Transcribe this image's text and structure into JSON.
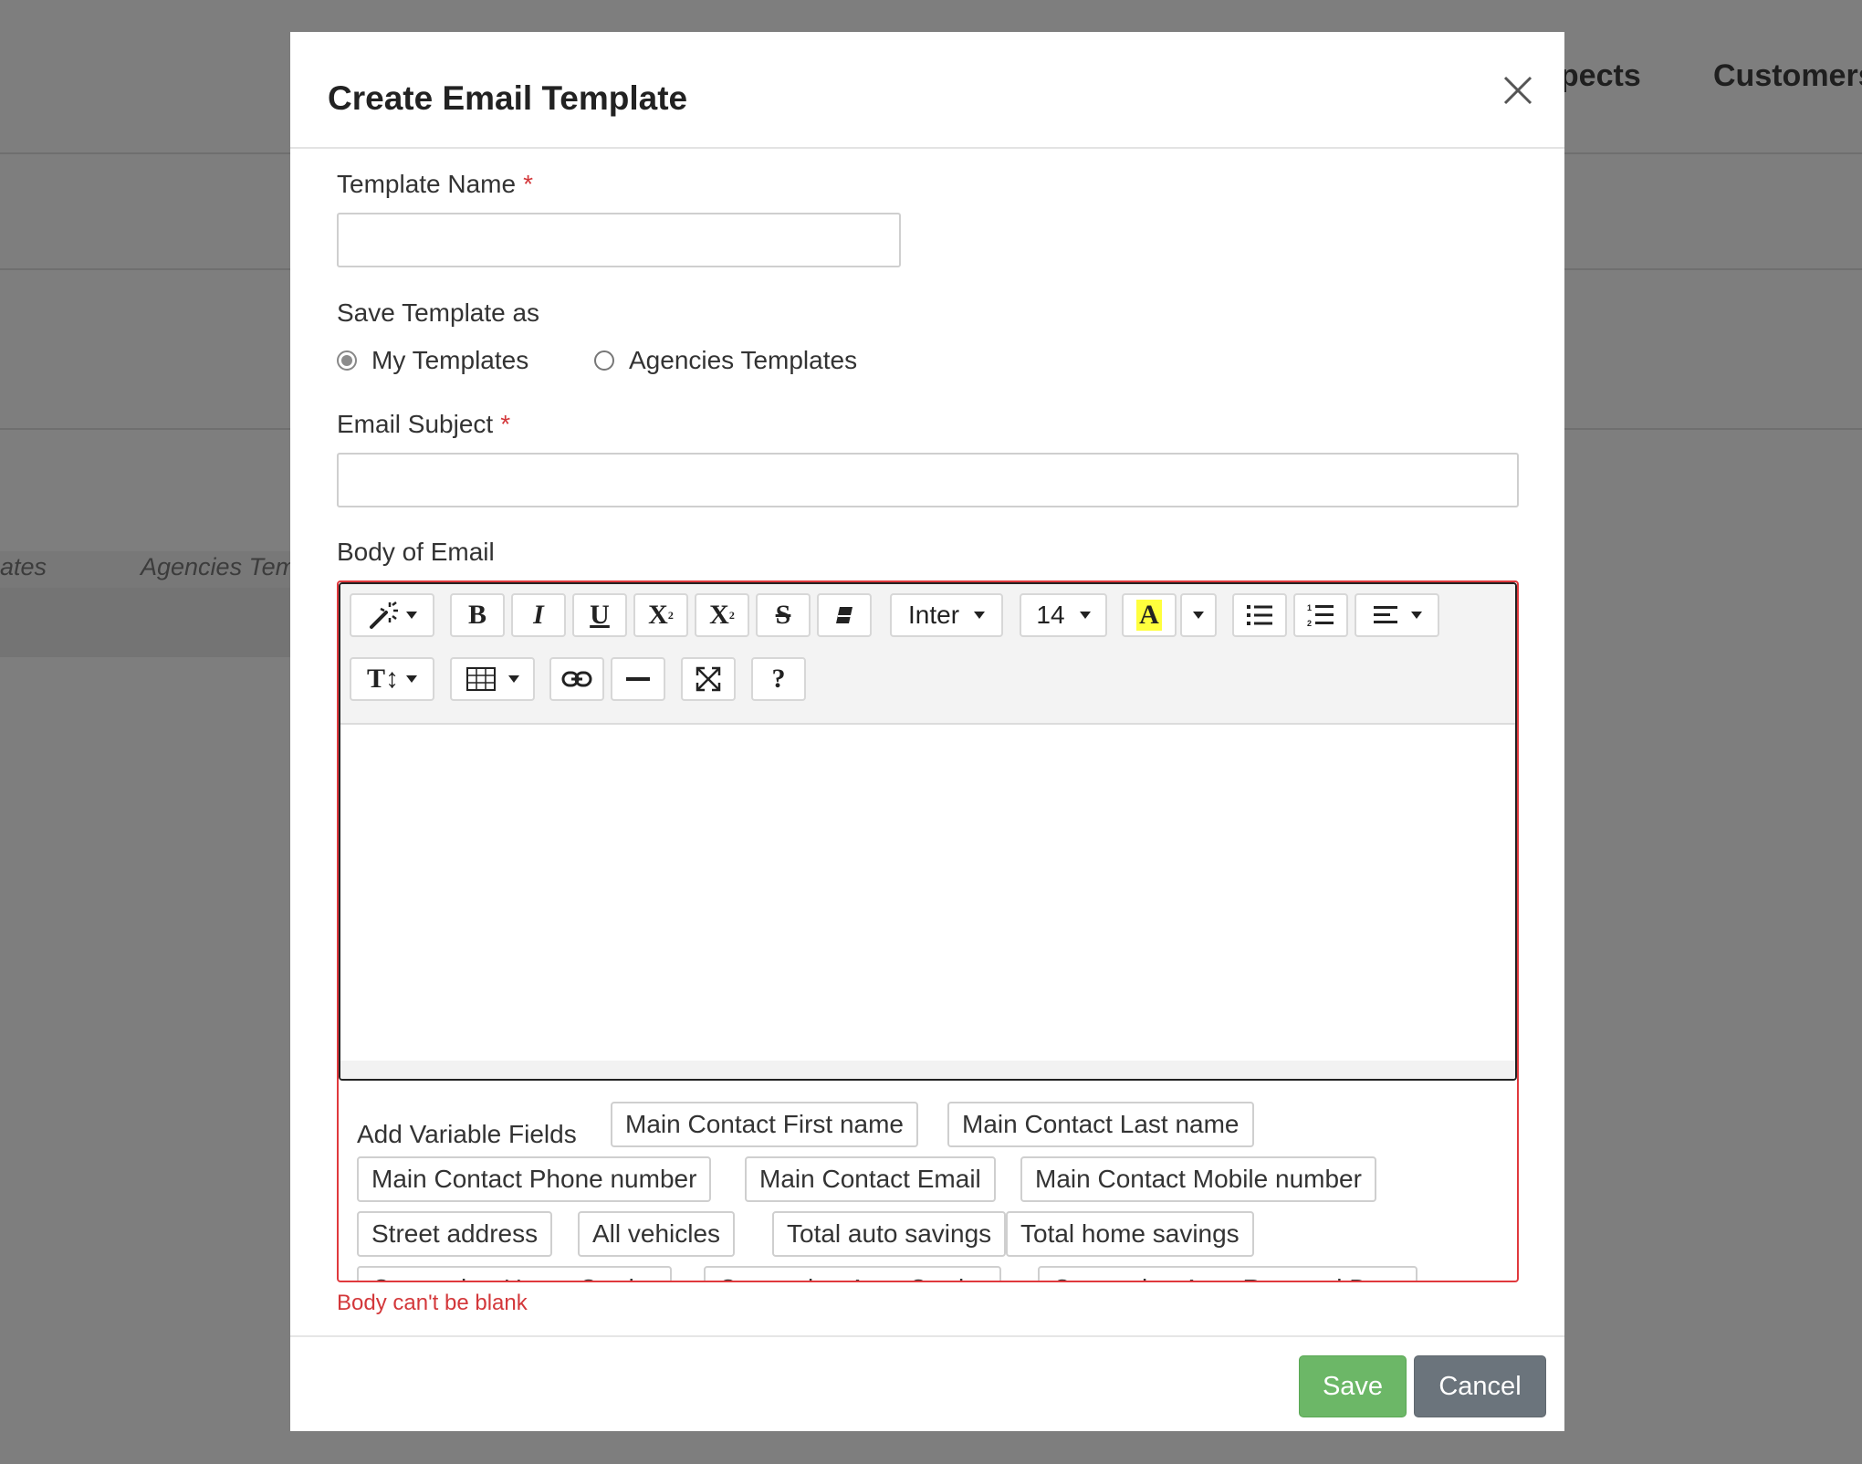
{
  "background": {
    "nav": [
      "spects",
      "Customers"
    ],
    "tabs": [
      "ates",
      "Agencies Tem"
    ]
  },
  "modal": {
    "title": "Create Email Template",
    "template_name": {
      "label": "Template Name",
      "required": "*",
      "value": ""
    },
    "save_as": {
      "label": "Save Template as",
      "options": [
        {
          "label": "My Templates",
          "selected": true
        },
        {
          "label": "Agencies Templates",
          "selected": false
        }
      ]
    },
    "email_subject": {
      "label": "Email Subject",
      "required": "*",
      "value": ""
    },
    "body": {
      "label": "Body of Email",
      "toolbar": {
        "style": "magic-icon",
        "bold": "B",
        "italic": "I",
        "underline": "U",
        "superscript": "X",
        "subscript": "X",
        "strikethrough": "S",
        "eraser": "eraser-icon",
        "font_family": "Inter",
        "font_size": "14",
        "color": "A",
        "unordered_list": "list-ul-icon",
        "ordered_list": "list-ol-icon",
        "paragraph": "align-left-icon",
        "height": "T",
        "table": "table-icon",
        "link": "link-icon",
        "hr": "hr-icon",
        "fullscreen": "fullscreen-icon",
        "help": "?"
      },
      "highlight_color": "#ffff3d",
      "content": ""
    },
    "variables": {
      "label": "Add Variable Fields",
      "fields": [
        "Main Contact First name",
        "Main Contact Last name",
        "Main Contact Phone number",
        "Main Contact Email",
        "Main Contact Mobile number",
        "Street address",
        "All vehicles",
        "Total auto savings",
        "Total home savings",
        "Competitor Home Carrier",
        "Competitor Auto Carrier",
        "Competitor Auto Renewal Date"
      ]
    },
    "error": "Body can't be blank",
    "footer": {
      "save": "Save",
      "cancel": "Cancel"
    },
    "colors": {
      "error": "#d3373a",
      "save": "#6cb767",
      "cancel": "#6b747c"
    }
  }
}
